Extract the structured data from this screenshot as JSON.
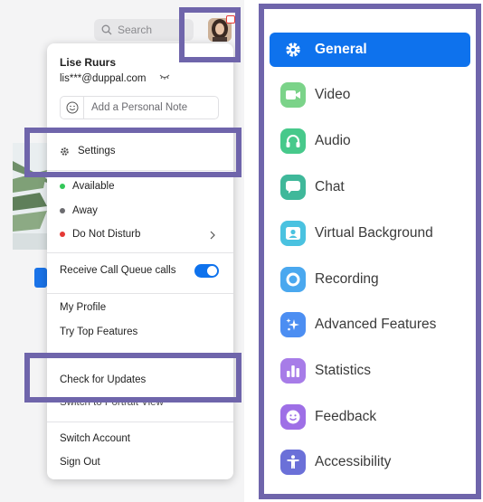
{
  "search": {
    "label": "Search"
  },
  "profile_menu": {
    "user_name": "Lise Ruurs",
    "user_email": "lis***@duppal.com",
    "personal_note_placeholder": "Add a Personal Note",
    "settings_label": "Settings",
    "statuses": [
      {
        "label": "Available",
        "color": "#34c759"
      },
      {
        "label": "Away",
        "color": "#6c6c70"
      },
      {
        "label": "Do Not Disturb",
        "color": "#e53935"
      }
    ],
    "call_queue_label": "Receive Call Queue calls",
    "call_queue_enabled": true,
    "my_profile_label": "My Profile",
    "try_top_features_label": "Try Top Features",
    "check_updates_label": "Check for Updates",
    "portrait_view_label": "Switch to Portrait View",
    "switch_account_label": "Switch Account",
    "sign_out_label": "Sign Out"
  },
  "settings_nav": {
    "items": [
      {
        "label": "General",
        "icon": "gear-icon",
        "color": "#0e72ed",
        "active": true
      },
      {
        "label": "Video",
        "icon": "video-camera-icon",
        "color": "#7bd389"
      },
      {
        "label": "Audio",
        "icon": "headphones-icon",
        "color": "#47c98b"
      },
      {
        "label": "Chat",
        "icon": "chat-bubble-icon",
        "color": "#3fb89a"
      },
      {
        "label": "Virtual Background",
        "icon": "person-portrait-icon",
        "color": "#4ac2e0"
      },
      {
        "label": "Recording",
        "icon": "record-circle-icon",
        "color": "#4aa8ef"
      },
      {
        "label": "Advanced Features",
        "icon": "sparkles-icon",
        "color": "#4c8ef2"
      },
      {
        "label": "Statistics",
        "icon": "bar-chart-icon",
        "color": "#a77ce8"
      },
      {
        "label": "Feedback",
        "icon": "smiley-icon",
        "color": "#9e6fe6"
      },
      {
        "label": "Accessibility",
        "icon": "accessibility-person-icon",
        "color": "#6b70d8"
      }
    ]
  },
  "colors": {
    "highlight_frame": "#6f65ab",
    "accent": "#0e72ed"
  }
}
